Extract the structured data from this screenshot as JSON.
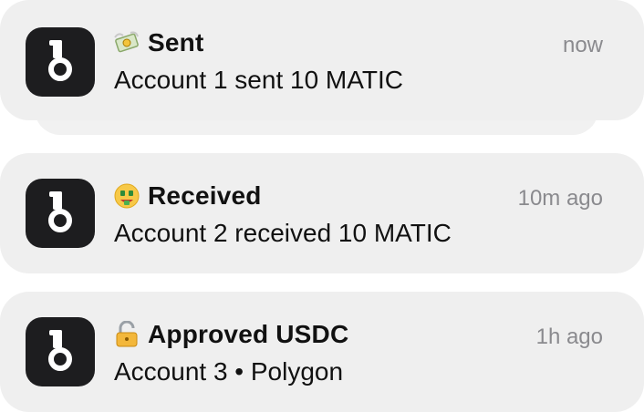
{
  "notifications": [
    {
      "emoji_icon": "money-with-wings-icon",
      "title": "Sent",
      "body": "Account 1 sent 10 MATIC",
      "time": "now"
    },
    {
      "emoji_icon": "money-mouth-face-icon",
      "title": "Received",
      "body": "Account 2 received 10 MATIC",
      "time": "10m ago"
    },
    {
      "emoji_icon": "unlocked-padlock-icon",
      "title": "Approved USDC",
      "body": "Account 3 • Polygon",
      "time": "1h ago"
    }
  ],
  "colors": {
    "card_background": "#efefef",
    "app_icon_background": "#1d1d1f",
    "title_text": "#111111",
    "time_text": "#8a8a8e"
  }
}
